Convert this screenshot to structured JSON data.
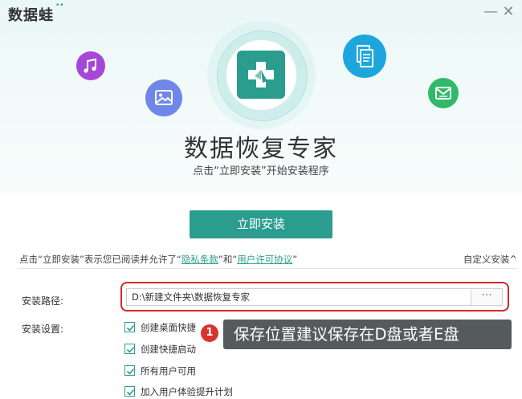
{
  "window": {
    "brand": "数据蛙",
    "minimize_glyph": "—",
    "close_glyph": "✕"
  },
  "hero": {
    "title": "数据恢复专家",
    "subtitle": "点击“立即安装”开始安装程序",
    "icons": [
      "music-icon",
      "image-icon",
      "app-logo-icon",
      "document-icon",
      "mail-icon"
    ]
  },
  "install_button": {
    "label": "立即安装"
  },
  "agreement": {
    "prefix": "点击“立即安装”表示您已阅读并允许了“",
    "privacy_link": "隐私条款",
    "middle": "”和“",
    "license_link": "用户许可协议",
    "suffix": "”"
  },
  "custom_install": {
    "label": "自定义安装",
    "arrow": "^"
  },
  "settings": {
    "path_label": "安装路径:",
    "path_value": "D:\\新建文件夹\\数据恢复专家",
    "browse_label": "···",
    "options_label": "安装设置:",
    "options": [
      {
        "label": "创建桌面快捷",
        "checked": true
      },
      {
        "label": "创建快捷启动",
        "checked": true
      },
      {
        "label": "所有用户可用",
        "checked": true
      },
      {
        "label": "加入用户体验提升计划",
        "checked": true
      }
    ]
  },
  "annotation": {
    "badge": "1",
    "text": "保存位置建议保存在D盘或者E盘"
  },
  "colors": {
    "accent": "#2a9d8f",
    "highlight_border": "#d12a2a",
    "callout_bg": "#555a5c",
    "badge": "#d8342f"
  }
}
